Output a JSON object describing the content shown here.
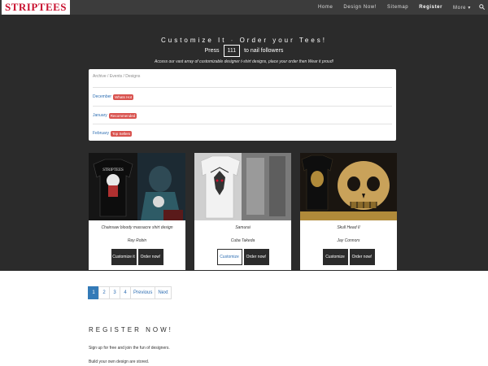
{
  "navbar": {
    "logo": "STRIPTEES",
    "links": [
      "Home",
      "Design Now!",
      "Sitemap",
      "Register",
      "More ▾"
    ],
    "search_icon": "search-icon"
  },
  "hero": {
    "headline": {
      "part1": "Customize It",
      "part2": " - ",
      "part3": "Order your Tees!"
    },
    "press_label": "Press",
    "counter": "111",
    "followers_label": "to nail followers",
    "access_text": "Access our vast array of customizable designer t-shirt designs, place your order then Wear it proud!"
  },
  "archive": {
    "title": "Archive / Events / Designs",
    "items": [
      {
        "label": "December",
        "badge": "Whats Hot"
      },
      {
        "label": "January",
        "badge": "Recommended"
      },
      {
        "label": "February",
        "badge": "Top Sellers"
      }
    ]
  },
  "cards": [
    {
      "title": "Chainsaw bloody massacre shirt design",
      "author": "Ray Robin",
      "buttons": [
        "Customize it",
        "Order now!"
      ]
    },
    {
      "title": "Samurai",
      "author": "Cuba Takeda",
      "buttons": [
        "Customize",
        "Order now!"
      ]
    },
    {
      "title": "Skull Head II",
      "author": "Jay Connors",
      "buttons": [
        "Customize",
        "Order now!"
      ]
    }
  ],
  "pagination": [
    "1",
    "2",
    "3",
    "4",
    "Previous",
    "Next"
  ],
  "register": {
    "title": "REGISTER NOW!",
    "line1": "Sign up for free and join the fun of designers.",
    "line2": "Build your own design are stored."
  },
  "colors": {
    "accent": "#337ab7",
    "badge": "#d9534f",
    "dark": "#2b2b2b",
    "logo": "#c8102e"
  }
}
